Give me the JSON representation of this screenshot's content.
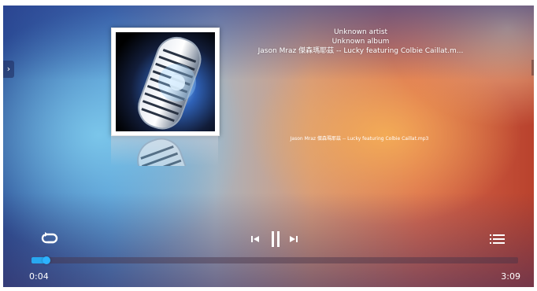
{
  "track": {
    "artist": "Unknown artist",
    "album": "Unknown album",
    "title": "Jason Mraz 傑森瑪耶茲 -- Lucky featuring Colbie Caillat.m...",
    "filename": "Jason Mraz 傑森瑪耶茲 -- Lucky featuring Colbie Caillat.mp3"
  },
  "playback": {
    "elapsed": "0:04",
    "duration": "3:09",
    "progress_fraction": 0.03,
    "state": "playing"
  },
  "controls": {
    "repeat_icon": "repeat-icon",
    "prev_icon": "skip-previous-icon",
    "pause_icon": "pause-icon",
    "next_icon": "skip-next-icon",
    "playlist_icon": "playlist-icon",
    "side_tab_icon": "chevron-right-icon"
  },
  "colors": {
    "accent": "#28a8f0",
    "text": "#ffffff"
  },
  "side_tab": {
    "glyph": "›"
  }
}
